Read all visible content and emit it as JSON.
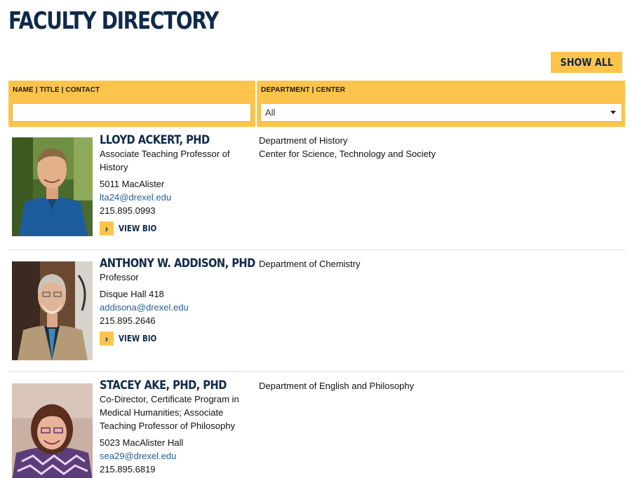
{
  "page": {
    "title": "FACULTY DIRECTORY"
  },
  "toolbar": {
    "show_all_label": "SHOW ALL"
  },
  "filters": {
    "name_label": "NAME | TITLE | CONTACT",
    "name_value": "",
    "dept_label": "DEPARTMENT | CENTER",
    "dept_selected": "All"
  },
  "colors": {
    "accent": "#fcc44b",
    "navy": "#0f2a4a",
    "link": "#1f5f97"
  },
  "faculty": [
    {
      "name": "LLOYD ACKERT, PHD",
      "title": "Associate Teaching Professor of History",
      "room": "5011 MacAlister",
      "email": "lta24@drexel.edu",
      "phone": "215.895.0993",
      "bio_label": "VIEW BIO",
      "bio_icon": "chevron-right-icon",
      "departments": [
        "Department of History",
        "Center for Science, Technology and Society"
      ]
    },
    {
      "name": "ANTHONY W. ADDISON, PHD",
      "title": "Professor",
      "room": "Disque Hall 418",
      "email": "addisona@drexel.edu",
      "phone": "215.895.2646",
      "bio_label": "VIEW BIO",
      "bio_icon": "chevron-right-icon",
      "departments": [
        "Department of Chemistry"
      ]
    },
    {
      "name": "STACEY AKE, PHD, PHD",
      "title": "Co-Director, Certificate Program in Medical Humanities; Associate Teaching Professor of Philosophy",
      "room": "5023 MacAlister Hall",
      "email": "sea29@drexel.edu",
      "phone": "215.895.6819",
      "departments": [
        "Department of English and Philosophy"
      ]
    }
  ]
}
